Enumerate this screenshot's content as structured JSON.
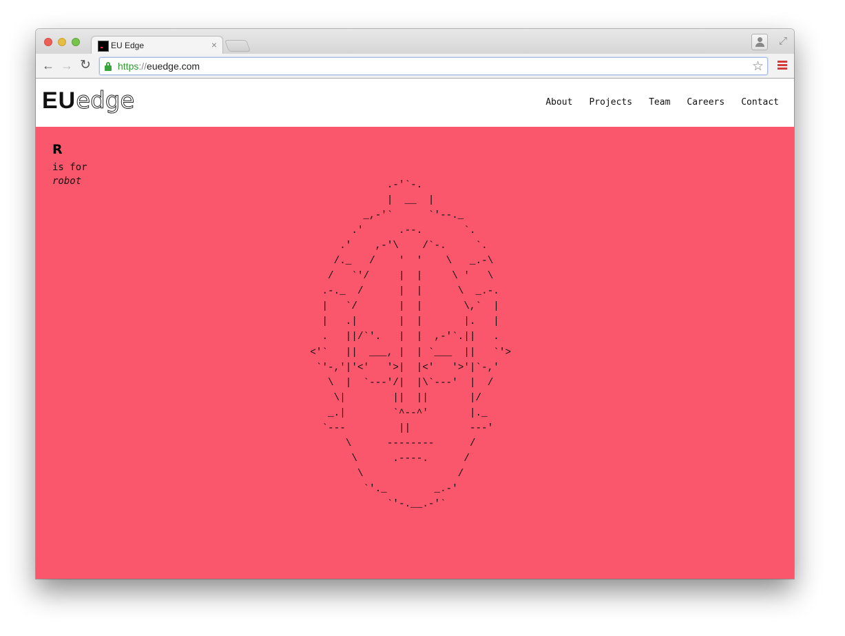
{
  "browser": {
    "tab_title": "EU Edge",
    "tab_close": "×",
    "url_scheme": "https",
    "url_sep": "://",
    "url_host": "euedge.com",
    "icons": [
      "back-arrow-icon",
      "forward-arrow-icon",
      "reload-icon",
      "lock-icon",
      "star-icon",
      "menu-icon",
      "profile-icon",
      "fullscreen-icon"
    ]
  },
  "site": {
    "logo_bold": "EU",
    "logo_outline": "edge",
    "nav": [
      "About",
      "Projects",
      "Team",
      "Careers",
      "Contact"
    ],
    "accent_color": "#fa566c"
  },
  "hero": {
    "letter": "R",
    "line1": "is for",
    "word": "robot",
    "ascii_art": "                 .-'`-.\n                 |  __  |\n             _,-'`      `'--._\n           .'      .--.       `.\n         .'    ,-'\\    /`-.     `.\n        /._   /    '  '    \\   _.-\\\n       /   `'/     |  |     \\ '   \\\n      .-._  /      |  |      \\  _.-.\n      |   `/       |  |       \\,`  |\n      |   .|       |  |       |.   |\n      .   ||/`'.   |  |  ,-'`.||   .\n    <'`   ||  ___, |  | `___  ||   `'>\n     `'-,'|'<'   '>|  |<'   '>'|`-,'\n       \\  |  `---'/|  |\\`---'  |  /\n        \\|        ||  ||       |/\n       _.|        `^--^'       |._\n      `---         ||          ---'\n          \\      --------      /\n           \\      .----.      /\n            \\                /\n             `'._        _.-'\n                 `'-.__.-'`"
  }
}
